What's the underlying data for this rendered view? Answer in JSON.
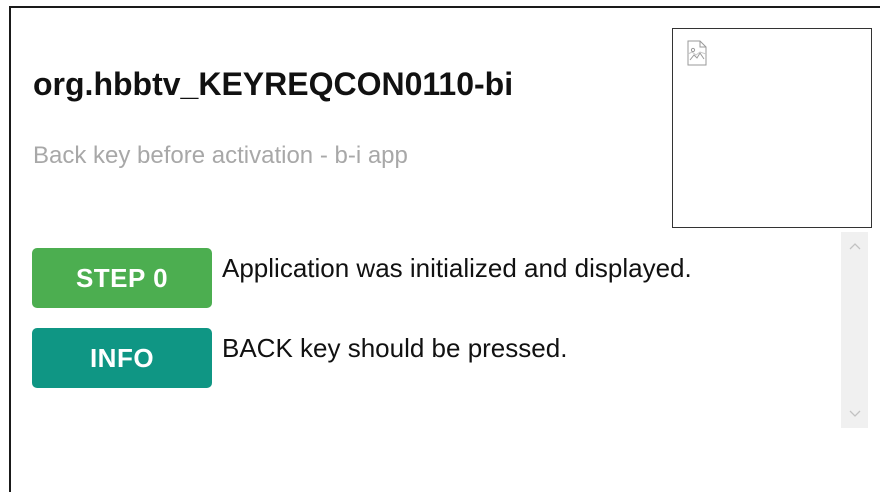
{
  "app": {
    "title": "org.hbbtv_KEYREQCON0110-bi",
    "subtitle": "Back key before activation - b-i app"
  },
  "video": {
    "icon": "broken-image-icon"
  },
  "log": {
    "entries": [
      {
        "badge": "STEP 0",
        "kind": "step",
        "badge_color": "#4cae50",
        "text": "Application was initialized and displayed."
      },
      {
        "badge": "INFO",
        "kind": "info",
        "badge_color": "#0f9684",
        "text": "BACK key should be pressed."
      }
    ]
  },
  "scrollbar": {
    "up_icon": "chevron-up-icon",
    "down_icon": "chevron-down-icon"
  }
}
